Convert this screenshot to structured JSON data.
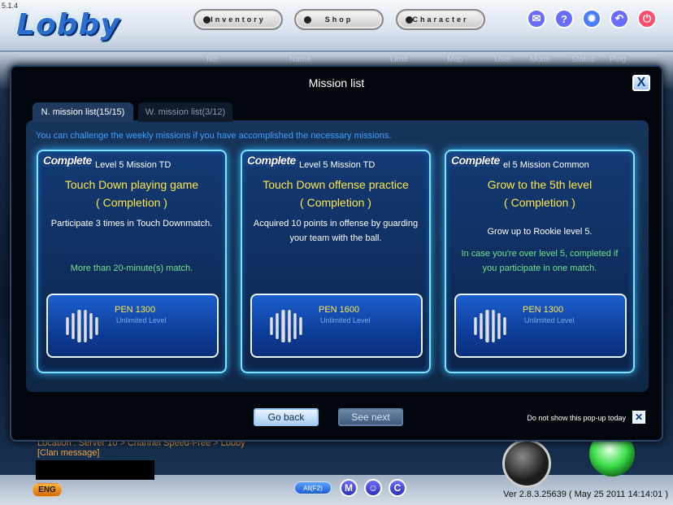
{
  "app": {
    "version_top": "5.1.4",
    "logo": "Lobby",
    "nav": [
      "Inventory",
      "Shop",
      "Character"
    ],
    "top_icons": [
      "mail-icon",
      "help-icon",
      "settings-icon",
      "back-icon",
      "power-icon"
    ]
  },
  "background_table": {
    "headers": [
      "No.",
      "Name",
      "Limit",
      "Map",
      "User",
      "Mode",
      "Status",
      "Ping"
    ]
  },
  "modal": {
    "title": "Mission list",
    "close_label": "X",
    "tabs": [
      {
        "label": "N. mission list(15/15)",
        "active": true
      },
      {
        "label": "W. mission list(3/12)",
        "active": false
      }
    ],
    "info_text": "You can challenge the weekly missions if you have accomplished the necessary missions.",
    "cards": [
      {
        "badge": "Complete",
        "category": "Level 5 Mission TD",
        "title": "Touch Down playing game",
        "status": "( Completion )",
        "description": "Participate 3 times in Touch Downmatch.",
        "note": "More than 20-minute(s) match.",
        "reward_amount": "PEN 1300",
        "reward_sub": "Unlimited Level"
      },
      {
        "badge": "Complete",
        "category": "Level 5 Mission TD",
        "title": "Touch Down offense practice",
        "status": "( Completion )",
        "description": "Acquired 10 points in offense by guarding your team with the ball.",
        "note": "",
        "reward_amount": "PEN 1600",
        "reward_sub": "Unlimited Level"
      },
      {
        "badge": "Complete",
        "category": "el 5 Mission Common",
        "title": "Grow to the 5th level",
        "status": "( Completion )",
        "description": "Grow up to Rookie level 5.",
        "note": "In case you're over level 5, completed if you participate in one match.",
        "reward_amount": "PEN 1300",
        "reward_sub": "Unlimited Level"
      }
    ],
    "buttons": {
      "go_back": "Go back",
      "see_next": "See next"
    },
    "dont_show_label": "Do not show this pop-up today",
    "dont_show_checked": true
  },
  "bottom": {
    "location": "Location : Server 10 > Channel Speed-Free > Lobby",
    "clan_message": "[Clan message]",
    "language": "ENG",
    "chat_mode": "All(F2)",
    "round_buttons": [
      "M",
      "group-icon",
      "C"
    ],
    "version": "Ver 2.8.3.25639 ( May 25 2011 14:14:01 )"
  },
  "colors": {
    "accent_yellow": "#ffe64a",
    "info_blue": "#3ea0ff",
    "note_green": "#6fe38c",
    "card_glow": "#7fe4ff"
  }
}
